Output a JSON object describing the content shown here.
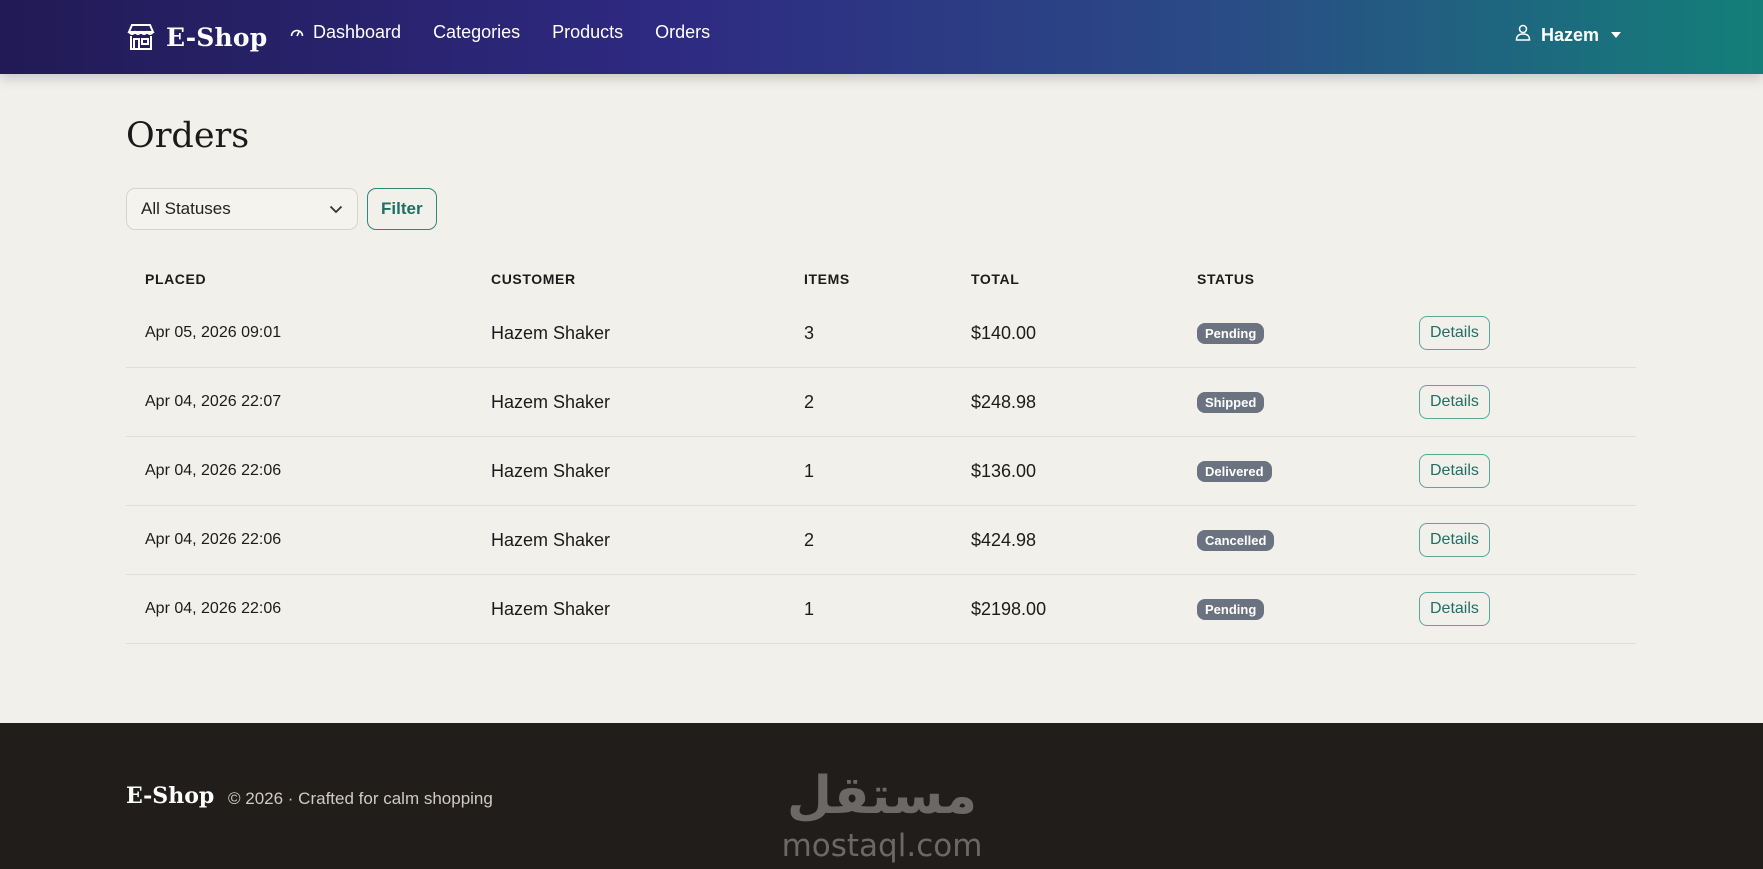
{
  "nav": {
    "brand": "E-Shop",
    "links": [
      {
        "label": "Dashboard",
        "icon": "dashboard-icon"
      },
      {
        "label": "Categories"
      },
      {
        "label": "Products"
      },
      {
        "label": "Orders"
      }
    ],
    "user": "Hazem"
  },
  "page": {
    "title": "Orders",
    "filter": {
      "selected": "All Statuses",
      "button": "Filter"
    }
  },
  "table": {
    "headers": [
      "PLACED",
      "CUSTOMER",
      "ITEMS",
      "TOTAL",
      "STATUS"
    ],
    "rows": [
      {
        "placed": "Apr 05, 2026 09:01",
        "customer": "Hazem Shaker",
        "items": "3",
        "total": "$140.00",
        "status": "Pending",
        "action": "Details"
      },
      {
        "placed": "Apr 04, 2026 22:07",
        "customer": "Hazem Shaker",
        "items": "2",
        "total": "$248.98",
        "status": "Shipped",
        "action": "Details"
      },
      {
        "placed": "Apr 04, 2026 22:06",
        "customer": "Hazem Shaker",
        "items": "1",
        "total": "$136.00",
        "status": "Delivered",
        "action": "Details"
      },
      {
        "placed": "Apr 04, 2026 22:06",
        "customer": "Hazem Shaker",
        "items": "2",
        "total": "$424.98",
        "status": "Cancelled",
        "action": "Details"
      },
      {
        "placed": "Apr 04, 2026 22:06",
        "customer": "Hazem Shaker",
        "items": "1",
        "total": "$2198.00",
        "status": "Pending",
        "action": "Details"
      }
    ]
  },
  "footer": {
    "brand": "E-Shop",
    "text": "© 2026  · Crafted for calm shopping",
    "watermark_text": "mostaql.com",
    "watermark_arabic": "مستقل"
  },
  "colors": {
    "nav_gradient_start": "#221a55",
    "nav_gradient_end": "#137f78",
    "accent": "#1f6f64",
    "badge": "#6b7280",
    "background": "#f2f0ea",
    "footer": "#201d1b"
  }
}
